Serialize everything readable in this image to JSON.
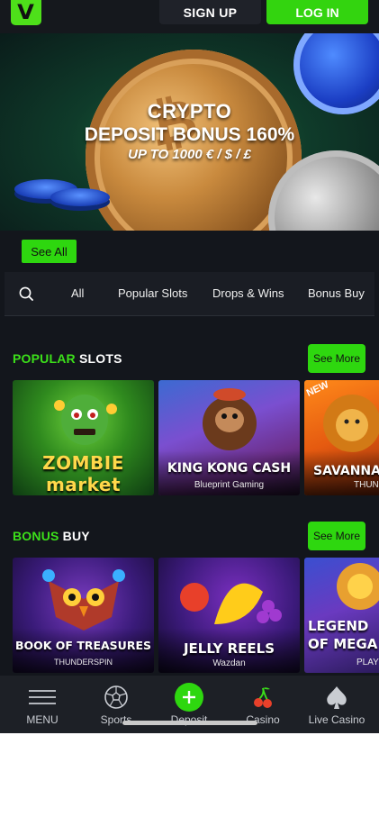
{
  "header": {
    "logo_letter": "V",
    "signup_label": "SIGN UP",
    "login_label": "LOG IN"
  },
  "banner": {
    "title": "CRYPTO",
    "subtitle": "DEPOSIT BONUS 160%",
    "note": "UP TO 1000 € / $ / £",
    "slides_total": 3,
    "active_slide": 3
  },
  "see_all_label": "See All",
  "tabs": [
    "All",
    "Popular Slots",
    "Drops & Wins",
    "Bonus Buy"
  ],
  "sections": [
    {
      "title_highlight": "POPULAR",
      "title_rest": "SLOTS",
      "see_more_label": "See More",
      "games": [
        {
          "name": "ZOMBIE market",
          "provider": ""
        },
        {
          "name": "KING KONG CASH",
          "provider": "Blueprint Gaming"
        },
        {
          "name": "SAVANNA",
          "provider": "THUND",
          "badge": "NEW"
        }
      ]
    },
    {
      "title_highlight": "BONUS",
      "title_rest": "BUY",
      "see_more_label": "See More",
      "games": [
        {
          "name": "BOOK OF TREASURES",
          "provider": "THUNDERSPIN"
        },
        {
          "name": "JELLY REELS",
          "provider": "Wazdan"
        },
        {
          "name": "LEGEND OF MEGA",
          "provider": "PLAY"
        }
      ]
    }
  ],
  "bottom_nav": [
    {
      "label": "MENU",
      "icon": "menu-icon"
    },
    {
      "label": "Sports",
      "icon": "soccer-ball-icon"
    },
    {
      "label": "Deposit",
      "icon": "plus-icon"
    },
    {
      "label": "Casino",
      "icon": "cherry-icon"
    },
    {
      "label": "Live Casino",
      "icon": "spade-icon"
    }
  ],
  "colors": {
    "accent": "#2ed70f",
    "background": "#13161c",
    "nav": "#1d2026"
  }
}
